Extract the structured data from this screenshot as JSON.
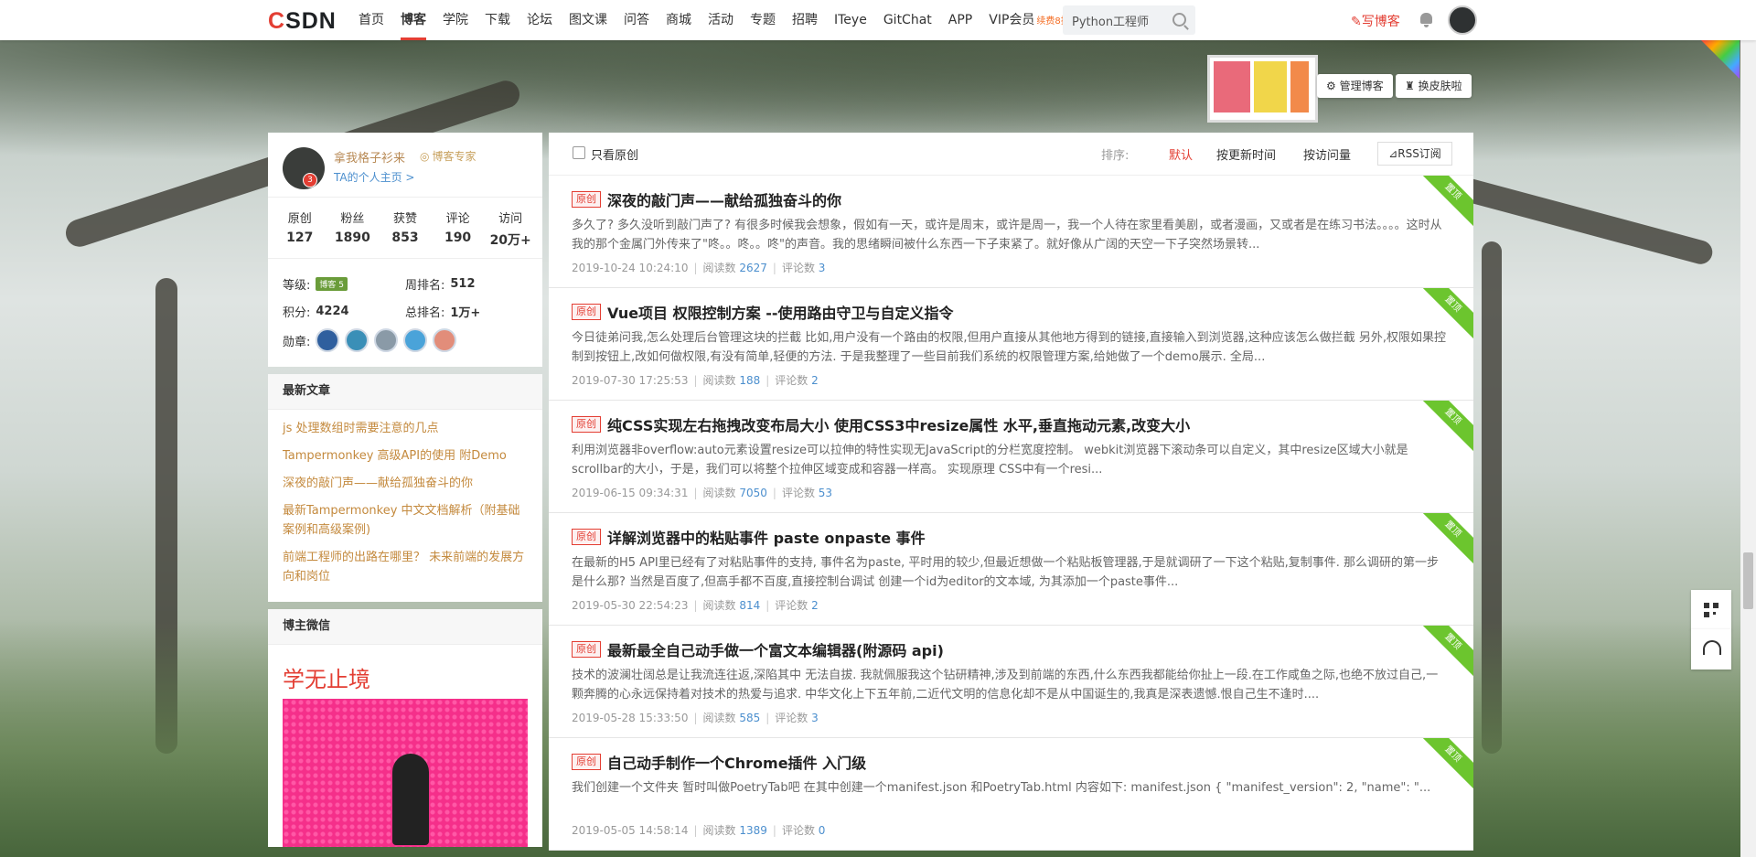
{
  "logo": "CSDN",
  "nav": {
    "items": [
      "首页",
      "博客",
      "学院",
      "下载",
      "论坛",
      "图文课",
      "问答",
      "商城",
      "活动",
      "专题",
      "招聘",
      "ITeye",
      "GitChat",
      "APP"
    ],
    "vip_label": "VIP会员",
    "vip_badge": "续费8折",
    "active": "博客"
  },
  "search": {
    "value": "Python工程师"
  },
  "write_blog": "写博客",
  "banner": {
    "manage_label": "管理博客",
    "skin_label": "换皮肤啦"
  },
  "profile": {
    "name": "拿我格子衫来",
    "badge": "博客专家",
    "level_number": "3",
    "home_link": "TA的个人主页 >",
    "stats": [
      {
        "label": "原创",
        "value": "127"
      },
      {
        "label": "粉丝",
        "value": "1890"
      },
      {
        "label": "获赞",
        "value": "853"
      },
      {
        "label": "评论",
        "value": "190"
      },
      {
        "label": "访问",
        "value": "20万+"
      }
    ],
    "level_label": "等级:",
    "level_badge": "博客 5",
    "week_rank_label": "周排名:",
    "week_rank": "512",
    "points_label": "积分:",
    "points": "4224",
    "total_rank_label": "总排名:",
    "total_rank": "1万+",
    "medals_label": "勋章:"
  },
  "recent": {
    "title": "最新文章",
    "items": [
      "js 处理数组时需要注意的几点",
      "Tampermonkey 高级API的使用 附Demo",
      "深夜的敲门声——献给孤独奋斗的你",
      "最新Tampermonkey 中文文档解析（附基础案例和高级案例)",
      "前端工程师的出路在哪里？ 未来前端的发展方向和岗位"
    ]
  },
  "wechat": {
    "title": "博主微信",
    "slogan": "学无止境"
  },
  "toolbar": {
    "only_original": "只看原创",
    "sort_label": "排序:",
    "sort_default": "默认",
    "sort_time": "按更新时间",
    "sort_views": "按访问量",
    "rss": "RSS订阅"
  },
  "articles": [
    {
      "badge": "原创",
      "title": "深夜的敲门声——献给孤独奋斗的你",
      "desc": "多久了? 多久没听到敲门声了? 有很多时候我会想象，假如有一天，或许是周末，或许是周一，我一个人待在家里看美剧，或者漫画，又或者是在练习书法。。。。这时从我的那个金属门外传来了\"咚。。咚。。咚\"的声音。我的思绪瞬间被什么东西一下子束紧了。就好像从广阔的天空一下子突然场景转...",
      "date": "2019-10-24 10:24:10",
      "views_label": "阅读数",
      "views": "2627",
      "comments_label": "评论数",
      "comments": "3",
      "pin": "置顶"
    },
    {
      "badge": "原创",
      "title": "Vue项目 权限控制方案 --使用路由守卫与自定义指令",
      "desc": "今日徒弟问我,怎么处理后台管理这块的拦截 比如,用户没有一个路由的权限,但用户直接从其他地方得到的链接,直接输入到浏览器,这种应该怎么做拦截 另外,权限如果控制到按钮上,改如何做权限,有没有简单,轻便的方法. 于是我整理了一些目前我们系统的权限管理方案,给她做了一个demo展示. 全局...",
      "date": "2019-07-30 17:25:53",
      "views_label": "阅读数",
      "views": "188",
      "comments_label": "评论数",
      "comments": "2",
      "pin": "置顶"
    },
    {
      "badge": "原创",
      "title": "纯CSS实现左右拖拽改变布局大小 使用CSS3中resize属性 水平,垂直拖动元素,改变大小",
      "desc": "利用浏览器非overflow:auto元素设置resize可以拉伸的特性实现无JavaScript的分栏宽度控制。 webkit浏览器下滚动条可以自定义，其中resize区域大小就是scrollbar的大小，于是，我们可以将整个拉伸区域变成和容器一样高。 实现原理 CSS中有一个resi...",
      "date": "2019-06-15 09:34:31",
      "views_label": "阅读数",
      "views": "7050",
      "comments_label": "评论数",
      "comments": "53",
      "pin": "置顶"
    },
    {
      "badge": "原创",
      "title": "详解浏览器中的粘贴事件 paste onpaste 事件",
      "desc": "在最新的H5 API里已经有了对粘贴事件的支持, 事件名为paste, 平时用的较少,但最近想做一个粘贴板管理器,于是就调研了一下这个粘贴,复制事件. 那么调研的第一步是什么那? 当然是百度了,但高手都不百度,直接控制台调试 创建一个id为editor的文本域, 为其添加一个paste事件...",
      "date": "2019-05-30 22:54:23",
      "views_label": "阅读数",
      "views": "814",
      "comments_label": "评论数",
      "comments": "2",
      "pin": "置顶"
    },
    {
      "badge": "原创",
      "title": "最新最全自己动手做一个富文本编辑器(附源码 api)",
      "desc": "技术的波澜壮阔总是让我流连往返,深陷其中 无法自拔. 我就佩服我这个钻研精神,涉及到前端的东西,什么东西我都能给你扯上一段.在工作咸鱼之际,也绝不放过自己,一颗奔腾的心永远保持着对技术的热爱与追求. 中华文化上下五年前,二近代文明的信息化却不是从中国诞生的,我真是深表遗憾.恨自己生不逢时....",
      "date": "2019-05-28 15:33:50",
      "views_label": "阅读数",
      "views": "585",
      "comments_label": "评论数",
      "comments": "3",
      "pin": "置顶"
    },
    {
      "badge": "原创",
      "title": "自己动手制作一个Chrome插件 入门级",
      "desc": "我们创建一个文件夹 暂时叫做PoetryTab吧 在其中创建一个manifest.json 和PoetryTab.html 内容如下: manifest.json { \"manifest_version\": 2, \"name\": \"...",
      "date": "2019-05-05 14:58:14",
      "views_label": "阅读数",
      "views": "1389",
      "comments_label": "评论数",
      "comments": "0",
      "pin": "置顶"
    }
  ],
  "colors": {
    "brand_red": "#e33e33",
    "pin_green": "#6cc52e",
    "link_orange": "#c48a3e"
  },
  "icons": [
    "search-icon",
    "bell-icon",
    "qr-code-icon",
    "headset-icon",
    "check-icon"
  ]
}
